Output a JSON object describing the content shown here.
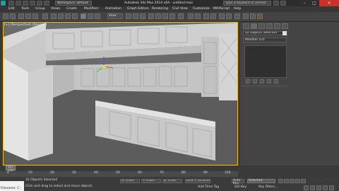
{
  "titlebar": {
    "workspace": "Workspace: Default",
    "title": "Autodesk 3ds Max 2014 x64 - untitled.max",
    "search_placeholder": "Type a keyword or phrase"
  },
  "menu": [
    "Edit",
    "Tools",
    "Group",
    "Views",
    "Create",
    "Modifiers",
    "Animation",
    "Graph Editors",
    "Rendering",
    "Civil View",
    "Customize",
    "MAXScript",
    "Help"
  ],
  "toolbar": {
    "view_dropdown": "View"
  },
  "viewport": {
    "label": "[+] [Perspective] [Shaded]"
  },
  "command_panel": {
    "objects_selected": "32 Objects Selected",
    "modifier_list": "Modifier List"
  },
  "timeline": {
    "frame": "0 / 100",
    "ticks": [
      "0",
      "10",
      "20",
      "30",
      "40",
      "50",
      "60",
      "70",
      "80",
      "90",
      "100"
    ]
  },
  "status": {
    "maxscript_label": "Filename: C:",
    "objects_selected": "32 Objects Selected",
    "prompt": "Click and drag to select and move objects",
    "x": "X: 0.0m",
    "y": "Y: 0.0m",
    "z": "Z: 0.0m",
    "grid": "Grid = 10.0cm",
    "auto_key": "Auto Key",
    "selected": "Selected",
    "set_key": "Set Key",
    "key_filters": "Key Filters...",
    "add_time_tag": "Add Time Tag"
  },
  "colors": {
    "viewport_border": "#f0c000",
    "close_button": "#c9322b",
    "app_icon": "#15a3a3"
  }
}
